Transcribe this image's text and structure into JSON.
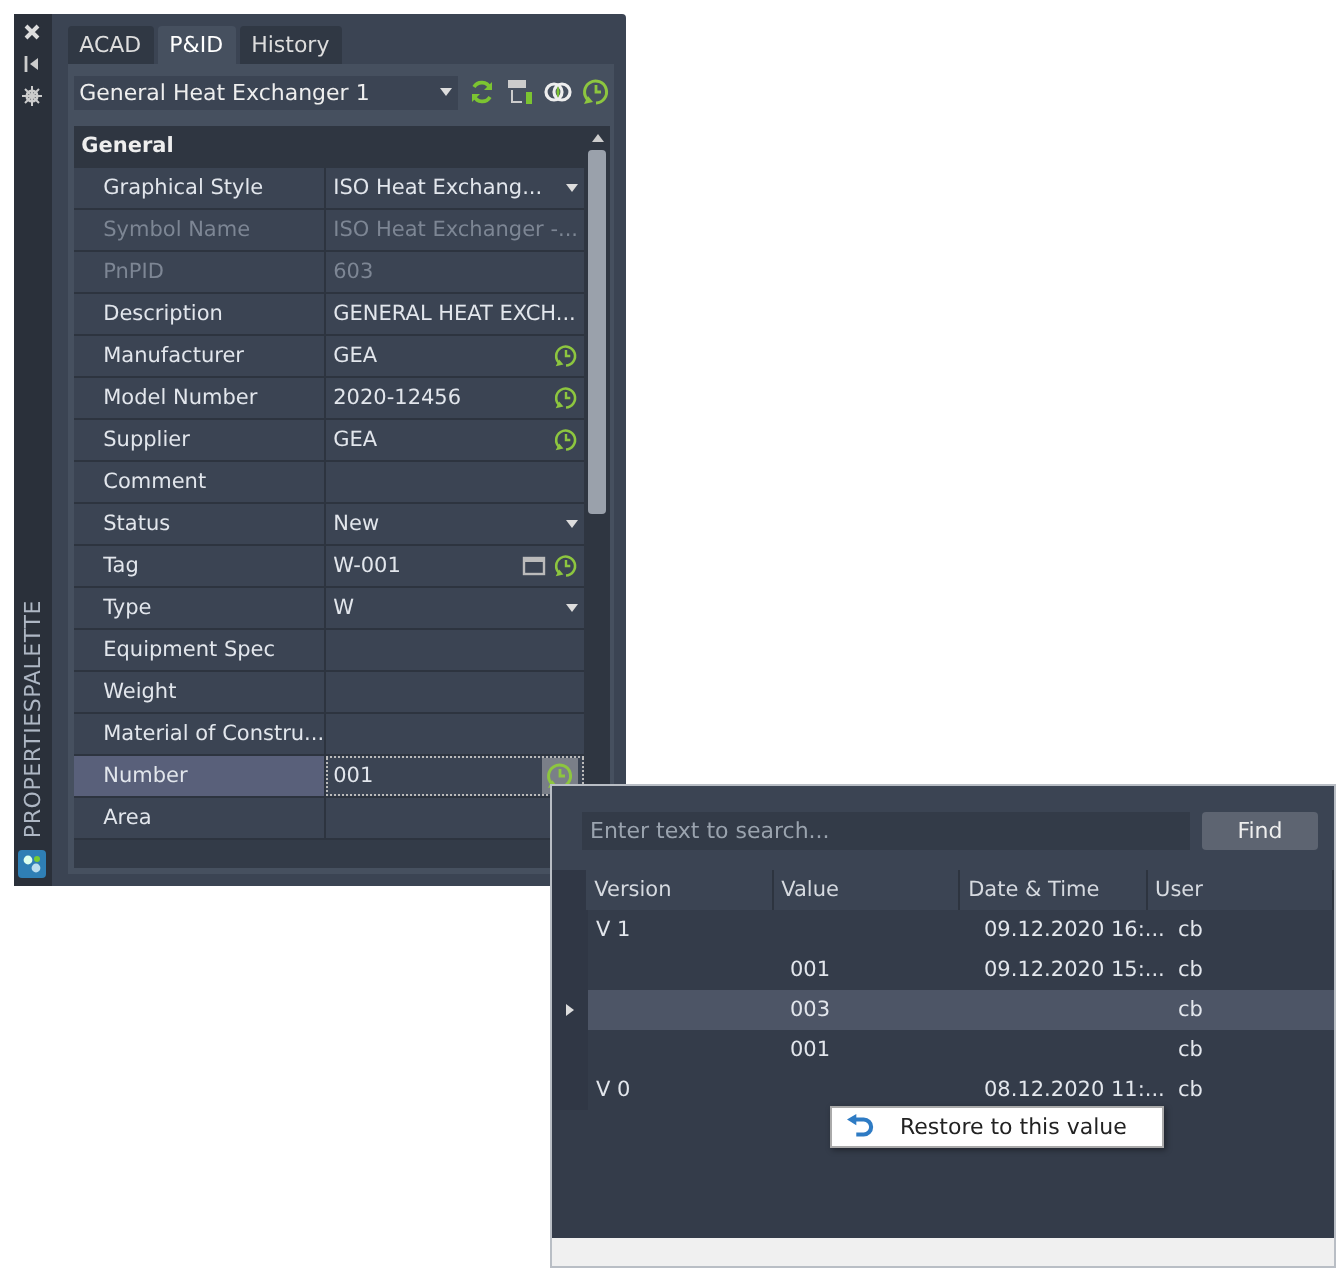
{
  "palette": {
    "side_title": "PROPERTIESPALETTE",
    "tabs": [
      {
        "label": "ACAD",
        "selected": false
      },
      {
        "label": "P&ID",
        "selected": true
      },
      {
        "label": "History",
        "selected": false
      }
    ],
    "object_select": {
      "value": "General Heat Exchanger 1"
    },
    "section": "General",
    "rows": [
      {
        "label": "Graphical Style",
        "value": "ISO Heat Exchang...",
        "disabled": false,
        "dropdown": true,
        "history": false,
        "browse": false,
        "selected": false
      },
      {
        "label": "Symbol Name",
        "value": "ISO Heat Exchanger -...",
        "disabled": true,
        "dropdown": false,
        "history": false,
        "browse": false,
        "selected": false
      },
      {
        "label": "PnPID",
        "value": "603",
        "disabled": true,
        "dropdown": false,
        "history": false,
        "browse": false,
        "selected": false
      },
      {
        "label": "Description",
        "value": "GENERAL HEAT EXCH...",
        "disabled": false,
        "dropdown": false,
        "history": false,
        "browse": false,
        "selected": false
      },
      {
        "label": "Manufacturer",
        "value": "GEA",
        "disabled": false,
        "dropdown": false,
        "history": true,
        "browse": false,
        "selected": false
      },
      {
        "label": "Model Number",
        "value": "2020-12456",
        "disabled": false,
        "dropdown": false,
        "history": true,
        "browse": false,
        "selected": false
      },
      {
        "label": "Supplier",
        "value": "GEA",
        "disabled": false,
        "dropdown": false,
        "history": true,
        "browse": false,
        "selected": false
      },
      {
        "label": "Comment",
        "value": "",
        "disabled": false,
        "dropdown": false,
        "history": false,
        "browse": false,
        "selected": false
      },
      {
        "label": "Status",
        "value": "New",
        "disabled": false,
        "dropdown": true,
        "history": false,
        "browse": false,
        "selected": false
      },
      {
        "label": "Tag",
        "value": "W-001",
        "disabled": false,
        "dropdown": false,
        "history": true,
        "browse": true,
        "selected": false
      },
      {
        "label": "Type",
        "value": "W",
        "disabled": false,
        "dropdown": true,
        "history": false,
        "browse": false,
        "selected": false
      },
      {
        "label": "Equipment Spec",
        "value": "",
        "disabled": false,
        "dropdown": false,
        "history": false,
        "browse": false,
        "selected": false
      },
      {
        "label": "Weight",
        "value": "",
        "disabled": false,
        "dropdown": false,
        "history": false,
        "browse": false,
        "selected": false
      },
      {
        "label": "Material of Constru...",
        "value": "",
        "disabled": false,
        "dropdown": false,
        "history": false,
        "browse": false,
        "selected": false
      },
      {
        "label": "Number",
        "value": "001",
        "disabled": false,
        "dropdown": false,
        "history": true,
        "browse": false,
        "selected": true
      },
      {
        "label": "Area",
        "value": "",
        "disabled": false,
        "dropdown": false,
        "history": false,
        "browse": false,
        "selected": false
      }
    ]
  },
  "history": {
    "search": {
      "placeholder": "Enter text to search..."
    },
    "find_button": "Find",
    "columns": [
      "Version",
      "Value",
      "Date & Time",
      "User"
    ],
    "rows": [
      {
        "version": "V 1",
        "value": "",
        "datetime": "09.12.2020 16:...",
        "user": "cb",
        "selected": false
      },
      {
        "version": "",
        "value": "001",
        "datetime": "09.12.2020 15:...",
        "user": "cb",
        "selected": false
      },
      {
        "version": "",
        "value": "003",
        "datetime": "",
        "user": "cb",
        "selected": true
      },
      {
        "version": "",
        "value": "001",
        "datetime": "",
        "user": "cb",
        "selected": false
      },
      {
        "version": "V 0",
        "value": "",
        "datetime": "08.12.2020 11:...",
        "user": "cb",
        "selected": false
      }
    ],
    "context_menu": {
      "item": "Restore to this value"
    }
  }
}
